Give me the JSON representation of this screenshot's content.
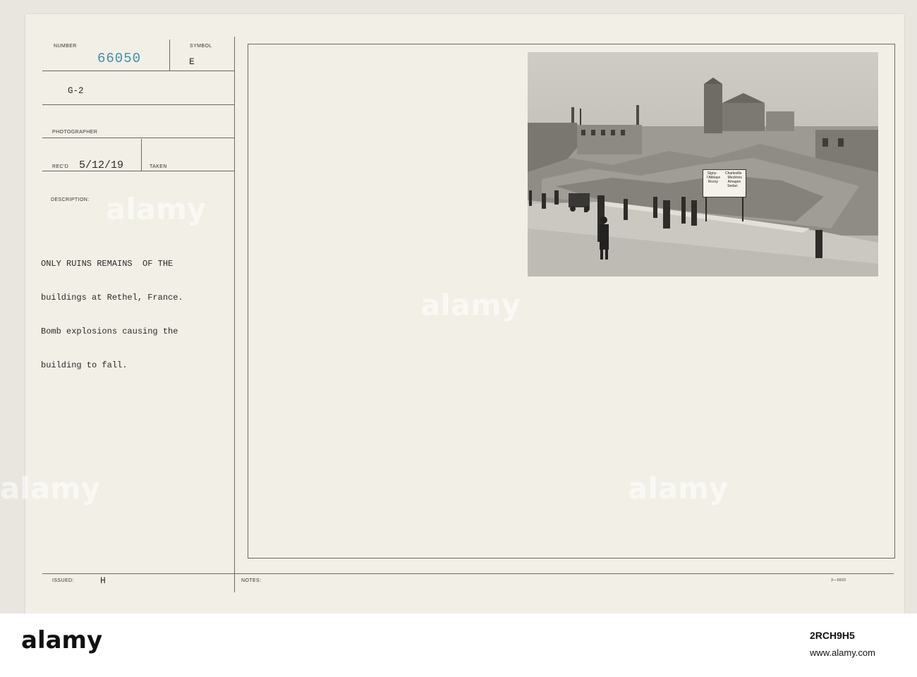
{
  "record": {
    "number_label": "NUMBER",
    "number": "66050",
    "symbol_label": "SYMBOL",
    "symbol": "E",
    "section": "G-2",
    "photographer_label": "PHOTOGRAPHER",
    "recd_label": "REC'D",
    "recd_date": "5/12/19",
    "taken_label": "TAKEN",
    "description_label": "DESCRIPTION:",
    "description_lines": [
      "ONLY RUINS REMAINS  OF THE",
      "buildings at Rethel, France.",
      "Bomb explosions causing the",
      "building to fall."
    ],
    "issued_label": "ISSUED:",
    "issued": "H",
    "notes_label": "NOTES:",
    "form_code": "3—5603"
  },
  "photo": {
    "sign_lines": [
      [
        "Signy-",
        "Charleville"
      ],
      [
        "l'Abbaye",
        "Mezières"
      ],
      [
        "Rozoy",
        "Amagne"
      ],
      [
        "",
        "Sedan"
      ]
    ]
  },
  "watermark": {
    "text": "alamy",
    "image_id": "2RCH9H5",
    "url": "www.alamy.com"
  }
}
